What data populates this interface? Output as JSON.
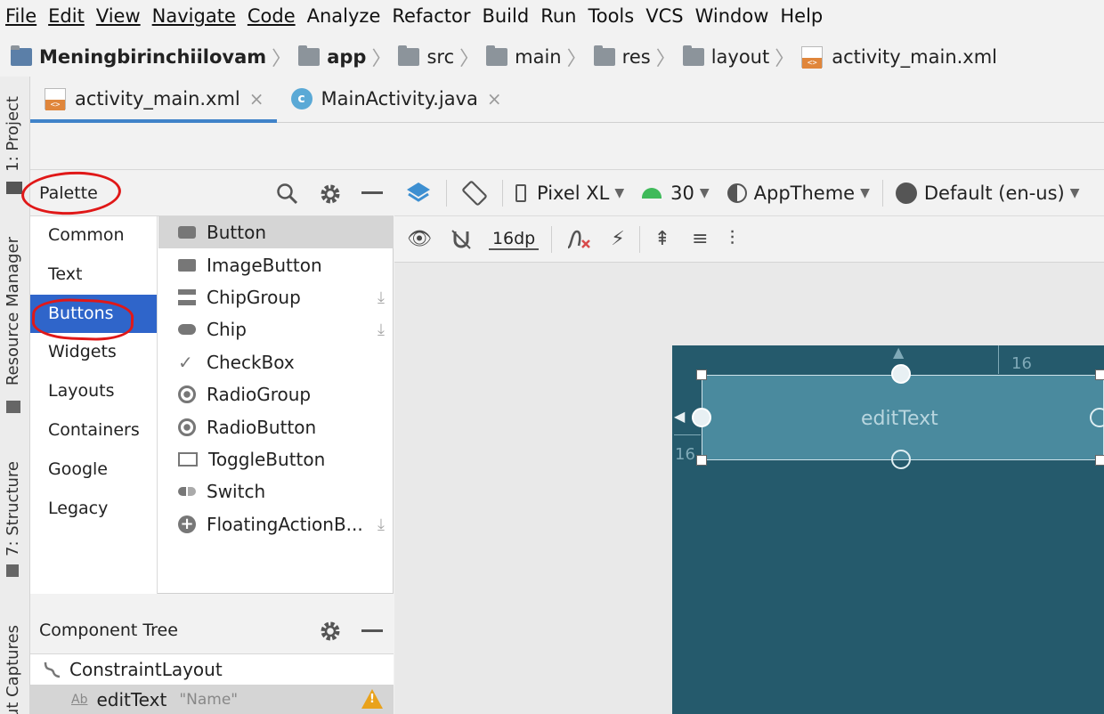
{
  "menu": [
    "File",
    "Edit",
    "View",
    "Navigate",
    "Code",
    "Analyze",
    "Refactor",
    "Build",
    "Run",
    "Tools",
    "VCS",
    "Window",
    "Help"
  ],
  "breadcrumb": [
    "Meningbirinchiilovam",
    "app",
    "src",
    "main",
    "res",
    "layout",
    "activity_main.xml"
  ],
  "tabs": {
    "active": "activity_main.xml",
    "other": "MainActivity.java",
    "close_glyph": "×"
  },
  "side_tools": {
    "project": "1: Project",
    "resource_manager": "Resource Manager",
    "structure": "7: Structure",
    "captures": "ut Captures"
  },
  "palette": {
    "title": "Palette",
    "categories": [
      "Common",
      "Text",
      "Buttons",
      "Widgets",
      "Layouts",
      "Containers",
      "Google",
      "Legacy"
    ],
    "selected_category": "Buttons",
    "components": [
      "Button",
      "ImageButton",
      "ChipGroup",
      "Chip",
      "CheckBox",
      "RadioGroup",
      "RadioButton",
      "ToggleButton",
      "Switch",
      "FloatingActionB..."
    ],
    "selected_component": "Button"
  },
  "toolbar": {
    "device": "Pixel XL",
    "api": "30",
    "theme": "AppTheme",
    "locale": "Default (en-us)",
    "margin": "16dp"
  },
  "component_tree": {
    "title": "Component Tree",
    "root": "ConstraintLayout",
    "child_name": "editText",
    "child_text": "\"Name\""
  },
  "canvas": {
    "edittext_label": "editText",
    "margin_top": "16",
    "margin_left": "16",
    "device_color": "#255a6c"
  },
  "colors": {
    "selection": "#2f65ca",
    "tab_underline": "#4083c9",
    "annotation": "#e01818",
    "warning": "#e9a21c"
  }
}
